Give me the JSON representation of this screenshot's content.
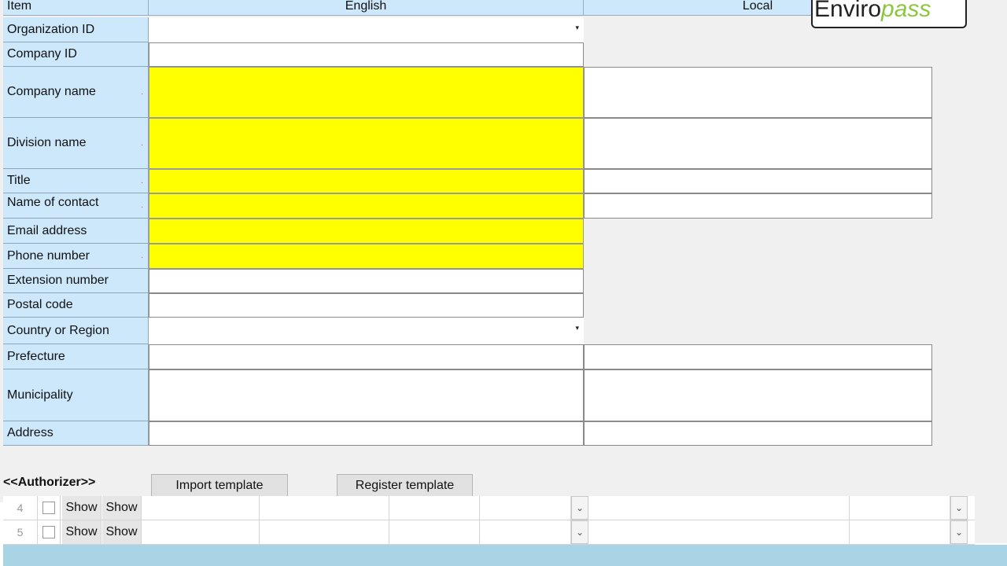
{
  "header": {
    "item": "Item",
    "english": "English",
    "local": "Local"
  },
  "logo": {
    "part1": "Enviro",
    "part2": "pass"
  },
  "fields": {
    "organization_id": "Organization ID",
    "company_id": "Company ID",
    "company_name": "Company name",
    "division_name": "Division name",
    "title": "Title",
    "name_of_contact": "Name of contact",
    "email_address": "Email address",
    "phone_number": "Phone number",
    "extension_number": "Extension number",
    "postal_code": "Postal code",
    "country_or_region": "Country or Region",
    "prefecture": "Prefecture",
    "municipality": "Municipality",
    "address": "Address"
  },
  "required_mark": ".",
  "dropdown_glyph": "▾",
  "authorizer_label": "<<Authorizer>>",
  "buttons": {
    "import_template": "Import template",
    "register_template": "Register template"
  },
  "grid_rows": [
    {
      "num": "4",
      "show1": "Show",
      "show2": "Show"
    },
    {
      "num": "5",
      "show1": "Show",
      "show2": "Show"
    }
  ],
  "grid_dropdown_glyph": "⌄",
  "colors": {
    "label_bg": "#cde8fb",
    "required_bg": "#ffff00",
    "footer_bar": "#a8d4e6"
  }
}
